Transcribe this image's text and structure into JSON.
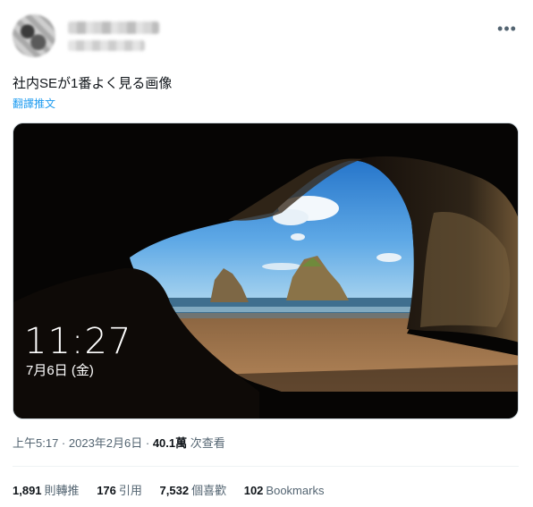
{
  "tweet": {
    "text": "社内SEが1番よく見る画像",
    "translate_label": "翻譯推文",
    "more_icon": "•••"
  },
  "lock_screen": {
    "time": "11:27",
    "date": "7月6日 (金)"
  },
  "meta": {
    "time": "上午5:17",
    "date": "2023年2月6日",
    "views_count": "40.1萬",
    "views_label": "次查看"
  },
  "stats": {
    "retweets_count": "1,891",
    "retweets_label": "則轉推",
    "quotes_count": "176",
    "quotes_label": "引用",
    "likes_count": "7,532",
    "likes_label": "個喜歡",
    "bookmarks_count": "102",
    "bookmarks_label": "Bookmarks"
  }
}
